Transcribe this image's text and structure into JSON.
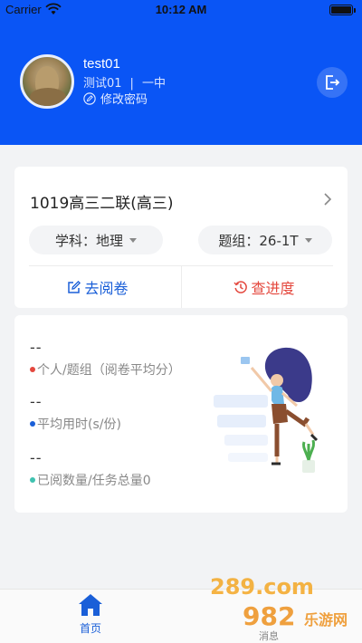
{
  "status_bar": {
    "carrier": "Carrier",
    "time": "10:12 AM"
  },
  "profile": {
    "username": "test01",
    "name": "测试01",
    "separator": "|",
    "school": "一中",
    "change_password": "修改密码"
  },
  "exam": {
    "title": "1019高三二联(高三)",
    "subject": "学科：地理",
    "group": "题组：26-1T",
    "go_grading": "去阅卷",
    "check_progress": "查进度"
  },
  "stats": [
    {
      "value": "--",
      "label": "个人/题组（阅卷平均分）",
      "dot_color": "#e4483e"
    },
    {
      "value": "--",
      "label": "平均用时(s/份)",
      "dot_color": "#1a5fd8"
    },
    {
      "value": "--",
      "label": "已阅数量/任务总量0",
      "dot_color": "#3fc2b0"
    }
  ],
  "tabbar": {
    "home": "首页"
  },
  "watermark": {
    "line1": "289.com",
    "line2": "982",
    "line3": "乐游网",
    "line4": "消息"
  },
  "colors": {
    "primary": "#0a55f5",
    "accent_blue": "#1a5fd8",
    "accent_red": "#e4483e"
  }
}
